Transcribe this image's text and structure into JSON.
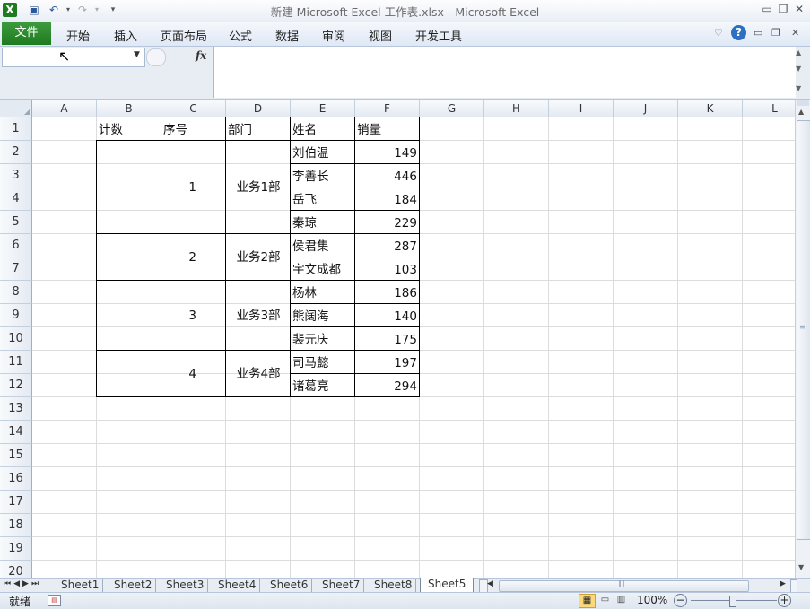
{
  "window": {
    "title": "新建 Microsoft Excel 工作表.xlsx - Microsoft Excel"
  },
  "ribbon": {
    "file_tab": "文件",
    "tabs": [
      "开始",
      "插入",
      "页面布局",
      "公式",
      "数据",
      "审阅",
      "视图",
      "开发工具"
    ]
  },
  "formula_bar": {
    "name_box_value": "",
    "fx_label": "fx",
    "formula_value": ""
  },
  "grid": {
    "columns": [
      "A",
      "B",
      "C",
      "D",
      "E",
      "F",
      "G",
      "H",
      "I",
      "J",
      "K",
      "L"
    ],
    "rows": [
      "1",
      "2",
      "3",
      "4",
      "5",
      "6",
      "7",
      "8",
      "9",
      "10",
      "11",
      "12",
      "13",
      "14",
      "15",
      "16",
      "17",
      "18",
      "19",
      "20"
    ],
    "headers": {
      "count": "计数",
      "seq": "序号",
      "dept": "部门",
      "name": "姓名",
      "sales": "销量"
    },
    "groups": [
      {
        "seq": "1",
        "dept": "业务1部"
      },
      {
        "seq": "2",
        "dept": "业务2部"
      },
      {
        "seq": "3",
        "dept": "业务3部"
      },
      {
        "seq": "4",
        "dept": "业务4部"
      }
    ],
    "records": [
      {
        "name": "刘伯温",
        "sales": "149"
      },
      {
        "name": "李善长",
        "sales": "446"
      },
      {
        "name": "岳飞",
        "sales": "184"
      },
      {
        "name": "秦琼",
        "sales": "229"
      },
      {
        "name": "侯君集",
        "sales": "287"
      },
      {
        "name": "宇文成都",
        "sales": "103"
      },
      {
        "name": "杨林",
        "sales": "186"
      },
      {
        "name": "熊阔海",
        "sales": "140"
      },
      {
        "name": "裴元庆",
        "sales": "175"
      },
      {
        "name": "司马懿",
        "sales": "197"
      },
      {
        "name": "诸葛亮",
        "sales": "294"
      }
    ]
  },
  "sheets": {
    "tabs": [
      "Sheet1",
      "Sheet2",
      "Sheet3",
      "Sheet4",
      "Sheet6",
      "Sheet7",
      "Sheet8",
      "Sheet5"
    ],
    "active": "Sheet5"
  },
  "status": {
    "ready": "就绪",
    "zoom": "100%"
  },
  "colors": {
    "file_tab": "#1e7b1e",
    "header_bg": "#e4eaf2",
    "gridline": "#dadcdd"
  }
}
